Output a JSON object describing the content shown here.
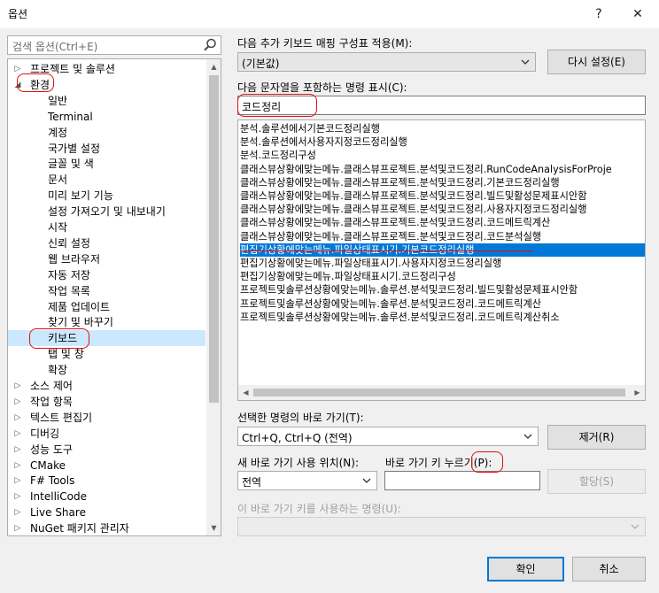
{
  "window": {
    "title": "옵션",
    "help_glyph": "?",
    "close_glyph": "✕"
  },
  "search": {
    "placeholder": "검색 옵션(Ctrl+E)"
  },
  "tree": {
    "items": [
      {
        "label": "프로젝트 및 솔루션",
        "level": 0,
        "arrow": "▷"
      },
      {
        "label": "환경",
        "level": 0,
        "arrow": "◢"
      },
      {
        "label": "일반",
        "level": 1
      },
      {
        "label": "Terminal",
        "level": 1
      },
      {
        "label": "계정",
        "level": 1
      },
      {
        "label": "국가별 설정",
        "level": 1
      },
      {
        "label": "글꼴 및 색",
        "level": 1
      },
      {
        "label": "문서",
        "level": 1
      },
      {
        "label": "미리 보기 기능",
        "level": 1
      },
      {
        "label": "설정 가져오기 및 내보내기",
        "level": 1
      },
      {
        "label": "시작",
        "level": 1
      },
      {
        "label": "신뢰 설정",
        "level": 1
      },
      {
        "label": "웹 브라우저",
        "level": 1
      },
      {
        "label": "자동 저장",
        "level": 1
      },
      {
        "label": "작업 목록",
        "level": 1
      },
      {
        "label": "제품 업데이트",
        "level": 1
      },
      {
        "label": "찾기 및 바꾸기",
        "level": 1
      },
      {
        "label": "키보드",
        "level": 1,
        "selected": true
      },
      {
        "label": "탭 및 창",
        "level": 1
      },
      {
        "label": "확장",
        "level": 1
      },
      {
        "label": "소스 제어",
        "level": 0,
        "arrow": "▷"
      },
      {
        "label": "작업 항목",
        "level": 0,
        "arrow": "▷"
      },
      {
        "label": "텍스트 편집기",
        "level": 0,
        "arrow": "▷"
      },
      {
        "label": "디버깅",
        "level": 0,
        "arrow": "▷"
      },
      {
        "label": "성능 도구",
        "level": 0,
        "arrow": "▷"
      },
      {
        "label": "CMake",
        "level": 0,
        "arrow": "▷"
      },
      {
        "label": "F# Tools",
        "level": 0,
        "arrow": "▷"
      },
      {
        "label": "IntelliCode",
        "level": 0,
        "arrow": "▷"
      },
      {
        "label": "Live Share",
        "level": 0,
        "arrow": "▷"
      },
      {
        "label": "NuGet 패키지 관리자",
        "level": 0,
        "arrow": "▷"
      }
    ]
  },
  "mapping": {
    "label": "다음 추가 키보드 매핑 구성표 적용(M):",
    "value": "(기본값)",
    "reset_button": "다시 설정(E)"
  },
  "filter": {
    "label": "다음 문자열을 포함하는 명령 표시(C):",
    "value": "코드정리"
  },
  "commands": [
    "분석.솔루션에서기본코드정리실행",
    "분석.솔루션에서사용자지정코드정리실행",
    "분석.코드정리구성",
    "클래스뷰상황에맞는메뉴.클래스뷰프로젝트.분석및코드정리.RunCodeAnalysisForProje",
    "클래스뷰상황에맞는메뉴.클래스뷰프로젝트.분석및코드정리.기본코드정리실행",
    "클래스뷰상황에맞는메뉴.클래스뷰프로젝트.분석및코드정리.빌드및활성문제표시안함",
    "클래스뷰상황에맞는메뉴.클래스뷰프로젝트.분석및코드정리.사용자지정코드정리실행",
    "클래스뷰상황에맞는메뉴.클래스뷰프로젝트.분석및코드정리.코드메트릭계산",
    "클래스뷰상황에맞는메뉴.클래스뷰프로젝트.분석및코드정리.코드분석실행",
    "편집기상황에맞는메뉴.파일상태표시기.기본코드정리실행",
    "편집기상황에맞는메뉴.파일상태표시기.사용자지정코드정리실행",
    "편집기상황에맞는메뉴.파일상태표시기.코드정리구성",
    "프로젝트및솔루션상황에맞는메뉴.솔루션.분석및코드정리.빌드및활성문제표시안함",
    "프로젝트및솔루션상황에맞는메뉴.솔루션.분석및코드정리.코드메트릭계산",
    "프로젝트및솔루션상황에맞는메뉴.솔루션.분석및코드정리.코드메트릭계산취소"
  ],
  "selected_command_index": 9,
  "shortcuts": {
    "label": "선택한 명령의 바로 가기(T):",
    "value": "Ctrl+Q, Ctrl+Q (전역)",
    "remove_button": "제거(R)"
  },
  "new_shortcut": {
    "scope_label": "새 바로 가기 사용 위치(N):",
    "scope_value": "전역",
    "keys_label": "바로 가기 키 누르기(P):",
    "keys_value": "",
    "assign_button": "할당(S)"
  },
  "used_by": {
    "label": "이 바로 가기 키를 사용하는 명령(U):",
    "value": ""
  },
  "footer": {
    "ok_button": "확인",
    "cancel_button": "취소"
  }
}
